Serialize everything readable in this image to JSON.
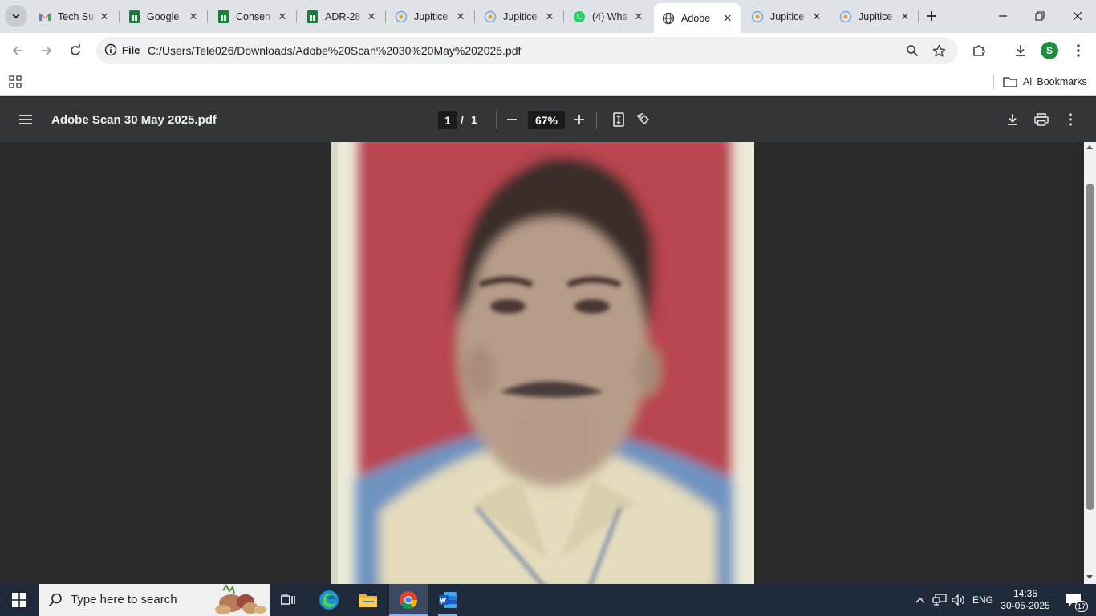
{
  "browser": {
    "tabs": [
      {
        "title": "Tech Su",
        "icon": "gmail-icon"
      },
      {
        "title": "Google",
        "icon": "sheets-icon"
      },
      {
        "title": "Consen",
        "icon": "sheets-icon"
      },
      {
        "title": "ADR-28",
        "icon": "sheets-icon"
      },
      {
        "title": "Jupitice",
        "icon": "jupitice-icon"
      },
      {
        "title": "Jupitice",
        "icon": "jupitice-icon"
      },
      {
        "title": "(4) Wha",
        "icon": "whatsapp-icon"
      },
      {
        "title": "Adobe",
        "icon": "globe-icon",
        "active": true
      },
      {
        "title": "Jupitice",
        "icon": "jupitice-icon"
      },
      {
        "title": "Jupitice",
        "icon": "jupitice-icon"
      }
    ],
    "omnibox": {
      "scheme_label": "File",
      "url": "C:/Users/Tele026/Downloads/Adobe%20Scan%2030%20May%202025.pdf"
    },
    "profile_initial": "S",
    "bookmarks": {
      "all_bookmarks_label": "All Bookmarks"
    },
    "accent_color": "#1a73e8"
  },
  "pdf_viewer": {
    "title": "Adobe Scan 30 May 2025.pdf",
    "current_page": "1",
    "page_separator": "/",
    "total_pages": "1",
    "zoom": "67%"
  },
  "taskbar": {
    "search_placeholder": "Type here to search",
    "language": "ENG",
    "time": "14:35",
    "date": "30-05-2025",
    "notification_count": "17"
  }
}
